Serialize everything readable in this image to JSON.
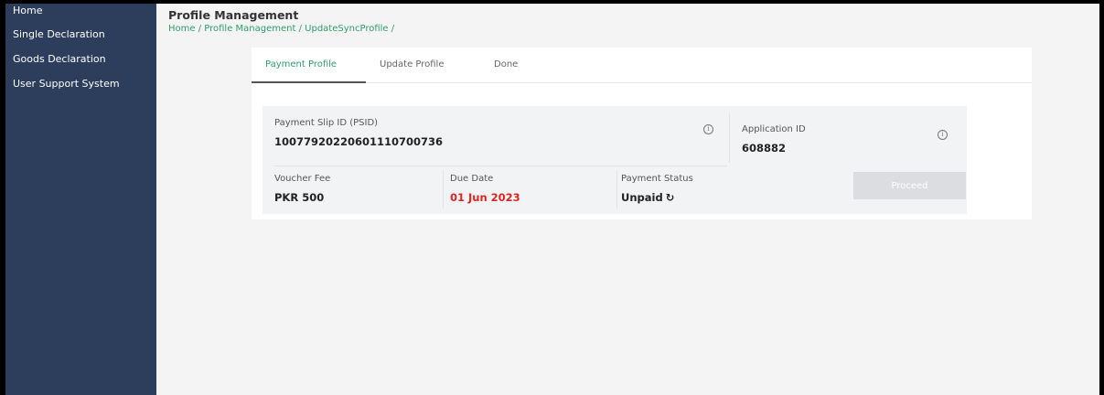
{
  "sidebar": {
    "items": [
      {
        "label": "Home"
      },
      {
        "label": "Single Declaration"
      },
      {
        "label": "Goods Declaration"
      },
      {
        "label": "User Support System"
      }
    ]
  },
  "header": {
    "title": "Profile Management",
    "breadcrumb": [
      "Home",
      "Profile Management",
      "UpdateSyncProfile"
    ],
    "separator": " / "
  },
  "tabs": [
    {
      "label": "Payment Profile",
      "active": true
    },
    {
      "label": "Update Profile",
      "active": false
    },
    {
      "label": "Done",
      "active": false
    }
  ],
  "payment": {
    "psid_label": "Payment Slip ID (PSID)",
    "psid_value": "10077920220601110700736",
    "app_id_label": "Application ID",
    "app_id_value": "608882",
    "voucher_fee_label": "Voucher Fee",
    "voucher_fee_value": "PKR 500",
    "due_date_label": "Due Date",
    "due_date_value": "01 Jun 2023",
    "status_label": "Payment Status",
    "status_value": "Unpaid",
    "proceed_label": "Proceed"
  },
  "icons": {
    "info": "info-circle-icon",
    "refresh": "refresh-icon"
  },
  "colors": {
    "sidebar_bg": "#2c3e5c",
    "accent": "#2f9e6a",
    "due_date": "#e02424",
    "button_disabled": "#dcdde0"
  }
}
